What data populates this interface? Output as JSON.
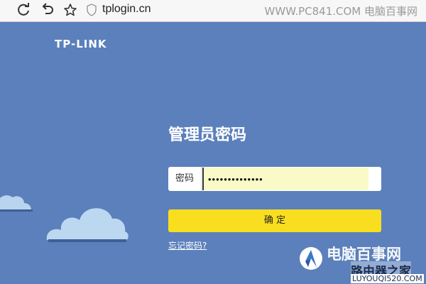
{
  "browser": {
    "url": "tplogin.cn",
    "site_mark": "WWW.PC841.COM 电脑百事网"
  },
  "page": {
    "logo_text": "TP-LINK",
    "title": "管理员密码",
    "password_label": "密码",
    "password_value": "••••••••••••••",
    "confirm_label": "确  定",
    "forgot_label": "忘记密码?"
  },
  "watermark": {
    "brand": "电脑百事网",
    "site2": "路由器之家",
    "url": "LUYOUQI520.COM"
  },
  "colors": {
    "background": "#5b80bb",
    "confirm_button": "#f8de1e",
    "input_fill": "#fafac8"
  }
}
